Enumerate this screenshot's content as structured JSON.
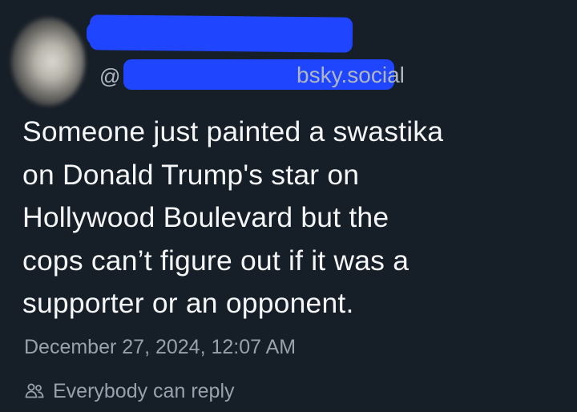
{
  "author": {
    "display_name": "",
    "handle_prefix": "@",
    "handle_suffix": "bsky.social",
    "avatar_icon": "avatar-blurred"
  },
  "post": {
    "lines": [
      "Someone just painted a swastika",
      "on Donald Trump's star on",
      "Hollywood Boulevard but the",
      "cops can’t figure out if it was a",
      "supporter or an opponent."
    ]
  },
  "meta": {
    "timestamp": "December 27, 2024, 12:07 AM",
    "reply_setting": "Everybody can reply",
    "reply_icon": "people-icon"
  },
  "colors": {
    "background": "#161e27",
    "text": "#f4f6f8",
    "muted": "#97a2ad",
    "redaction": "#1f45ff"
  }
}
